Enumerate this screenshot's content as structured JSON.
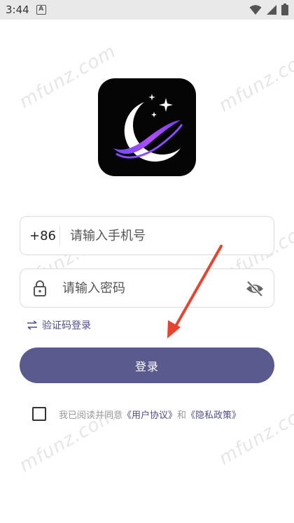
{
  "status_bar": {
    "time": "3:44",
    "notification_icon": "a-letter-icon"
  },
  "watermark": "mfunz.com",
  "login": {
    "country_code": "+86",
    "phone_placeholder": "请输入手机号",
    "password_placeholder": "请输入密码",
    "switch_label": "验证码登录",
    "login_button": "登录"
  },
  "agreement": {
    "prefix": "我已阅读并同意",
    "user_agreement": "《用户协议》",
    "and": "和",
    "privacy_policy": "《隐私政策》"
  },
  "colors": {
    "accent": "#5b5a8e",
    "link": "#4f4d8f",
    "annotation_arrow": "#e8432e"
  }
}
